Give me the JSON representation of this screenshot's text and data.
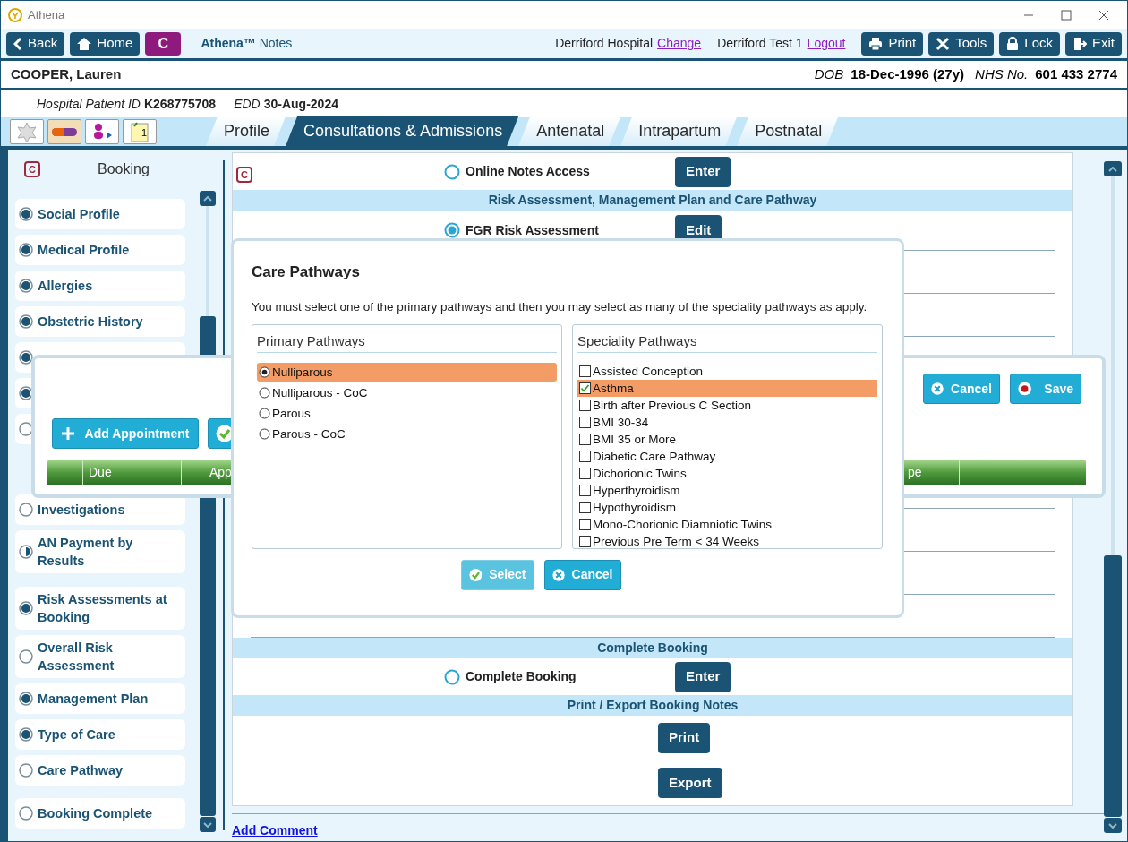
{
  "window": {
    "title": "Athena"
  },
  "toolbar": {
    "back": "Back",
    "home": "Home",
    "c_button": "C",
    "app_name": "**Athena™** Notes",
    "hospital": "Derriford Hospital",
    "change_link": "Change",
    "user": "Derriford Test 1",
    "logout_link": "Logout",
    "buttons": [
      {
        "kind": "print",
        "label": "Print"
      },
      {
        "kind": "tools",
        "label": "Tools"
      },
      {
        "kind": "lock",
        "label": "Lock"
      },
      {
        "kind": "exit",
        "label": "Exit"
      }
    ]
  },
  "patient": {
    "name": "COOPER, Lauren",
    "dob_label": "DOB",
    "dob": "18-Dec-1996 (27y)",
    "nhs_label": "NHS No.",
    "nhs": "601 433 2774",
    "id_label": "Hospital Patient ID",
    "id": "K268775708",
    "edd_label": "EDD",
    "edd": "30-Aug-2024"
  },
  "tool_icons": [
    {
      "kind": "puzzle"
    },
    {
      "kind": "pill"
    },
    {
      "kind": "person"
    },
    {
      "kind": "notepad",
      "badge": "1"
    }
  ],
  "tabs": [
    {
      "label": "Profile",
      "selected": false
    },
    {
      "label": "Consultations & Admissions",
      "selected": true
    },
    {
      "label": "Antenatal",
      "selected": false
    },
    {
      "label": "Intrapartum",
      "selected": false
    },
    {
      "label": "Postnatal",
      "selected": false
    }
  ],
  "sidebar": {
    "badge": "C",
    "title": "Booking",
    "groups": [
      [
        {
          "label": "Social Profile",
          "started": true,
          "complete": true
        },
        {
          "label": "Medical Profile",
          "started": true,
          "complete": true
        },
        {
          "label": "Allergies",
          "started": true,
          "complete": true
        },
        {
          "label": "Obstetric History",
          "started": true,
          "complete": true
        },
        {
          "started": true,
          "complete": true
        },
        {
          "started": true,
          "complete": true
        },
        {
          "started": false,
          "complete": false
        }
      ],
      [
        {
          "label": "Investigations",
          "started": false,
          "complete": false
        },
        {
          "label": "AN Payment by Results",
          "started": true,
          "complete": false
        }
      ],
      [
        {
          "label": "Risk Assessments at Booking",
          "started": true,
          "complete": true
        },
        {
          "label": "Overall Risk Assessment",
          "started": false,
          "complete": false
        },
        {
          "label": "Management Plan",
          "started": true,
          "complete": true
        },
        {
          "label": "Type of Care",
          "started": true,
          "complete": true
        },
        {
          "label": "Care Pathway",
          "started": false,
          "complete": false
        }
      ],
      [
        {
          "label": "Booking Complete",
          "started": false,
          "complete": false
        }
      ]
    ]
  },
  "content": {
    "badge": "C",
    "rows": [
      {
        "kind": "item",
        "label": "Online Notes Access",
        "selected": false,
        "button": "Enter"
      },
      {
        "kind": "section",
        "label": "Risk Assessment, Management Plan and Care Pathway"
      },
      {
        "kind": "item",
        "label": "FGR Risk Assessment",
        "selected": true,
        "button": "Edit"
      },
      {
        "kind": "covered"
      },
      {
        "kind": "section",
        "label": "Complete Booking"
      },
      {
        "kind": "item",
        "label": "Complete Booking",
        "selected": false,
        "button": "Enter"
      },
      {
        "kind": "section",
        "label": "Print / Export Booking Notes"
      },
      {
        "kind": "button",
        "button": "Print"
      },
      {
        "kind": "button",
        "button": "Export"
      }
    ]
  },
  "add_comment": "Add Comment",
  "appointments_dialog": {
    "add_button": "Add Appointment",
    "cancel_button": "Cancel",
    "save_button": "Save",
    "columns": [
      "Due",
      "App",
      "pe"
    ]
  },
  "care_pathways_dialog": {
    "title": "Care Pathways",
    "instruction": "You must select one of the primary pathways and then you may select as many of the speciality pathways as apply.",
    "primary": {
      "title": "Primary Pathways",
      "items": [
        {
          "label": "Nulliparous",
          "selected": true
        },
        {
          "label": "Nulliparous - CoC",
          "selected": false
        },
        {
          "label": "Parous",
          "selected": false
        },
        {
          "label": "Parous - CoC",
          "selected": false
        }
      ]
    },
    "speciality": {
      "title": "Speciality Pathways",
      "items": [
        {
          "label": "Assisted Conception",
          "checked": false,
          "selected": false
        },
        {
          "label": "Asthma",
          "checked": true,
          "selected": true
        },
        {
          "label": "Birth after Previous C Section",
          "checked": false,
          "selected": false
        },
        {
          "label": "BMI 30-34",
          "checked": false,
          "selected": false
        },
        {
          "label": "BMI 35 or More",
          "checked": false,
          "selected": false
        },
        {
          "label": "Diabetic Care Pathway",
          "checked": false,
          "selected": false
        },
        {
          "label": "Dichorionic Twins",
          "checked": false,
          "selected": false
        },
        {
          "label": "Hyperthyroidism",
          "checked": false,
          "selected": false
        },
        {
          "label": "Hypothyroidism",
          "checked": false,
          "selected": false
        },
        {
          "label": "Mono-Chorionic Diamniotic Twins",
          "checked": false,
          "selected": false
        },
        {
          "label": "Previous Pre Term < 34 Weeks",
          "checked": false,
          "selected": false
        }
      ]
    },
    "select_button": {
      "label": "Select",
      "disabled": true
    },
    "cancel_button": "Cancel"
  }
}
